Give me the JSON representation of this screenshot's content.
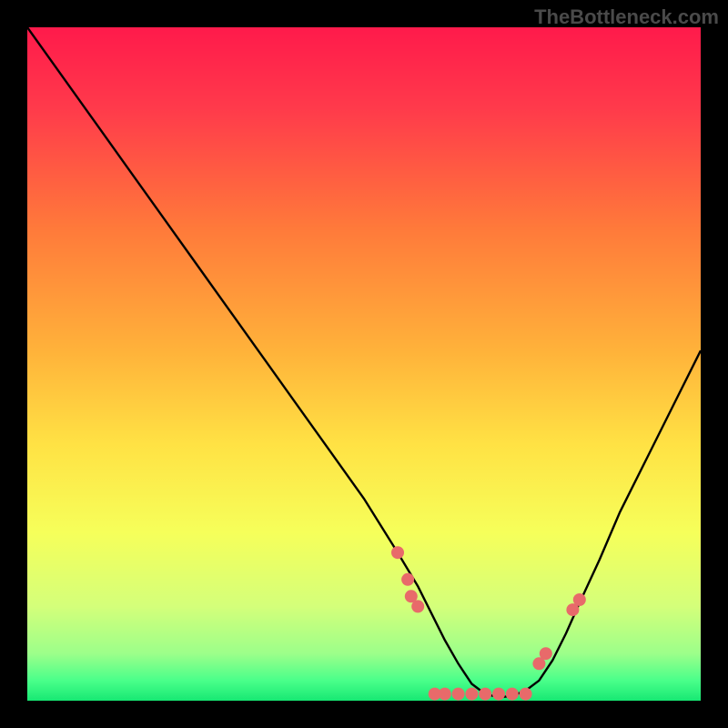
{
  "watermark": "TheBottleneck.com",
  "chart_data": {
    "type": "line",
    "title": "",
    "xlabel": "",
    "ylabel": "",
    "xlim": [
      0,
      100
    ],
    "ylim": [
      0,
      100
    ],
    "curve": {
      "name": "bottleneck-curve",
      "description": "V-shaped curve dipping to minimum around x≈68 then rising",
      "x": [
        0,
        5,
        10,
        15,
        20,
        25,
        30,
        35,
        40,
        45,
        50,
        55,
        58,
        60,
        62,
        64,
        66,
        68,
        70,
        72,
        74,
        76,
        78,
        80,
        82,
        85,
        88,
        92,
        96,
        100
      ],
      "y": [
        100,
        93,
        86,
        79,
        72,
        65,
        58,
        51,
        44,
        37,
        30,
        22,
        17,
        13,
        9,
        5.5,
        2.5,
        1,
        0.5,
        0.7,
        1.5,
        3,
        6,
        10,
        14.5,
        21,
        28,
        36,
        44,
        52
      ]
    },
    "points": {
      "name": "data-points",
      "description": "Pink scatter points near the curve trough",
      "x": [
        55,
        56.5,
        57,
        58,
        60.5,
        62,
        64,
        66,
        68,
        70,
        72,
        74,
        76,
        77,
        81,
        82
      ],
      "y": [
        22,
        18,
        15.5,
        14,
        1,
        1,
        1,
        1,
        1,
        1,
        1,
        1,
        5.5,
        7,
        13.5,
        15
      ]
    },
    "gradient_stops": [
      {
        "offset": 0.0,
        "color": "#ff1a4b"
      },
      {
        "offset": 0.12,
        "color": "#ff3a4b"
      },
      {
        "offset": 0.3,
        "color": "#ff7a3a"
      },
      {
        "offset": 0.48,
        "color": "#ffb23a"
      },
      {
        "offset": 0.62,
        "color": "#ffe244"
      },
      {
        "offset": 0.75,
        "color": "#f6ff5a"
      },
      {
        "offset": 0.86,
        "color": "#d4ff7a"
      },
      {
        "offset": 0.93,
        "color": "#9cff8a"
      },
      {
        "offset": 0.97,
        "color": "#4aff8a"
      },
      {
        "offset": 1.0,
        "color": "#17e873"
      }
    ],
    "point_color": "#e86a6a",
    "line_color": "#000000"
  }
}
